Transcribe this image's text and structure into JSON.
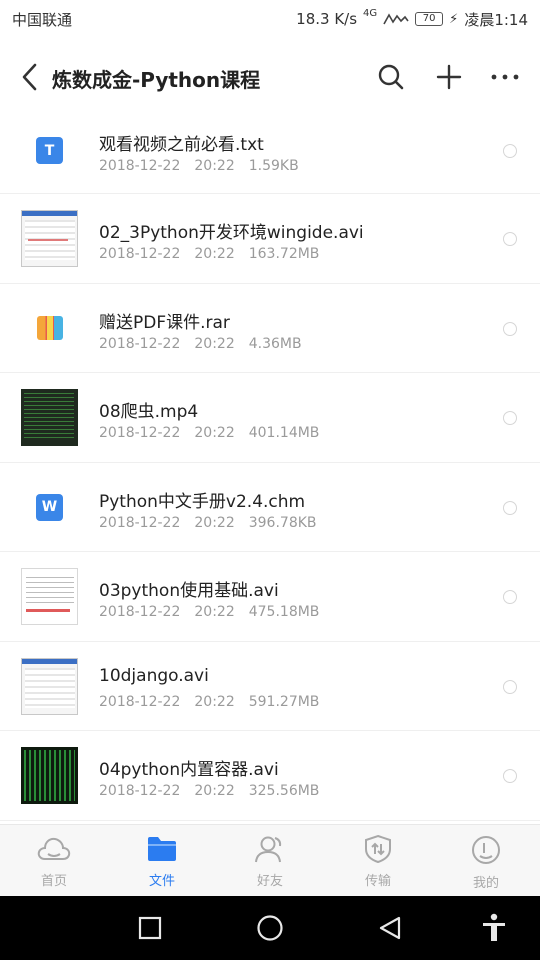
{
  "status": {
    "carrier": "中国联通",
    "net_speed": "18.3 K/s",
    "net_type": "4G",
    "battery": "70",
    "time": "凌晨1:14"
  },
  "header": {
    "title": "炼数成金-Python课程"
  },
  "files": [
    {
      "name": "观看视频之前必看.txt",
      "date": "2018-12-22",
      "time": "20:22",
      "size": "1.59KB",
      "thumb": "txt",
      "badge": "T"
    },
    {
      "name": "02_3Python开发环境wingide.avi",
      "date": "2018-12-22",
      "time": "20:22",
      "size": "163.72MB",
      "thumb": "ide-screenshot"
    },
    {
      "name": "赠送PDF课件.rar",
      "date": "2018-12-22",
      "time": "20:22",
      "size": "4.36MB",
      "thumb": "rar"
    },
    {
      "name": "08爬虫.mp4",
      "date": "2018-12-22",
      "time": "20:22",
      "size": "401.14MB",
      "thumb": "terminal-screenshot"
    },
    {
      "name": "Python中文手册v2.4.chm",
      "date": "2018-12-22",
      "time": "20:22",
      "size": "396.78KB",
      "thumb": "word",
      "badge": "W"
    },
    {
      "name": "03python使用基础.avi",
      "date": "2018-12-22",
      "time": "20:22",
      "size": "475.18MB",
      "thumb": "document-screenshot"
    },
    {
      "name": "10django.avi",
      "date": "2018-12-22",
      "time": "20:22",
      "size": "591.27MB",
      "thumb": "ide-screenshot"
    },
    {
      "name": "04python内置容器.avi",
      "date": "2018-12-22",
      "time": "20:22",
      "size": "325.56MB",
      "thumb": "matrix-screenshot"
    }
  ],
  "nav": {
    "home": "首页",
    "files": "文件",
    "friends": "好友",
    "transfer": "传输",
    "mine": "我的"
  },
  "colors": {
    "accent": "#2b7cf0",
    "inactive": "#a8a8a8",
    "meta_text": "#9a9a9a"
  }
}
